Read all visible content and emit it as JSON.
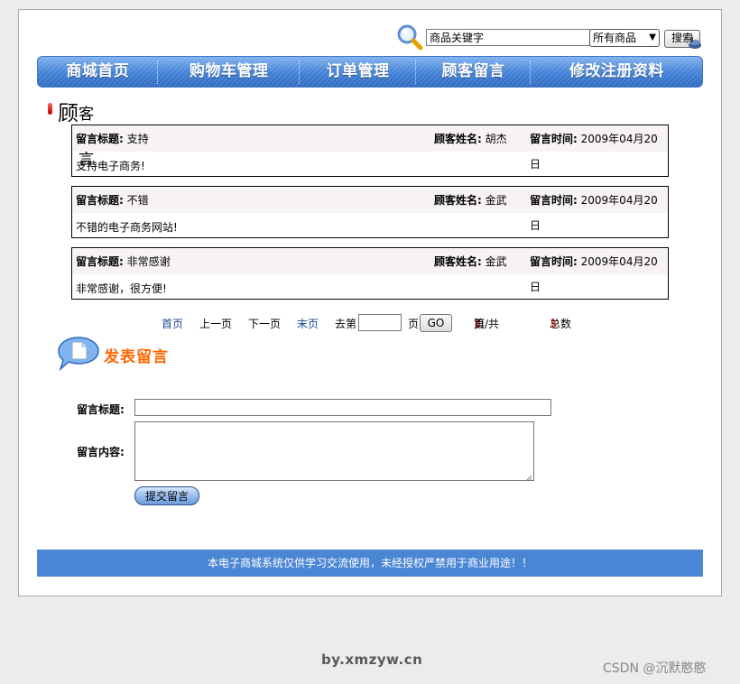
{
  "search": {
    "placeholder": "商品关键字",
    "category": "所有商品",
    "button": "搜索"
  },
  "nav": [
    {
      "label": "商城首页"
    },
    {
      "label": "购物车管理"
    },
    {
      "label": "订单管理"
    },
    {
      "label": "顾客留言"
    },
    {
      "label": "修改注册资料"
    }
  ],
  "section": {
    "title_first": "顾",
    "title_rest": "客留言"
  },
  "labels": {
    "msg_title": "留言标题:",
    "author": "顾客姓名:",
    "time": "留言时间:"
  },
  "messages": [
    {
      "title": "支持",
      "author": "胡杰",
      "time": "2009年04月20日",
      "content": "支持电子商务!"
    },
    {
      "title": "不错",
      "author": "金武",
      "time": "2009年04月20日",
      "content": "不错的电子商务网站!"
    },
    {
      "title": "非常感谢",
      "author": "金武",
      "time": "2009年04月20日",
      "content": "非常感谢，很方便!"
    }
  ],
  "pager": {
    "first": "首页",
    "prev": "上一页",
    "next": "下一页",
    "last": "末页",
    "goto_prefix": "去第",
    "goto_suffix": "页",
    "go": "GO",
    "status_a": "第",
    "current": "1",
    "status_b": "页/共",
    "total_pages": "1",
    "status_c": "页",
    "count_label": "总数",
    "count": "3"
  },
  "post": {
    "heading": "发表留言",
    "title_label": "留言标题:",
    "content_label": "留言内容:",
    "submit": "提交留言"
  },
  "footer": {
    "notice": "本电子商城系统仅供学习交流使用，未经授权严禁用于商业用途！！",
    "site": "by.xmzyw.cn",
    "watermark": "CSDN @沉默憨憨"
  },
  "colors": {
    "nav": "#3f7fd6",
    "footer": "#4a86d4",
    "post_heading": "#ff6600",
    "pager_highlight": "#d00000"
  }
}
